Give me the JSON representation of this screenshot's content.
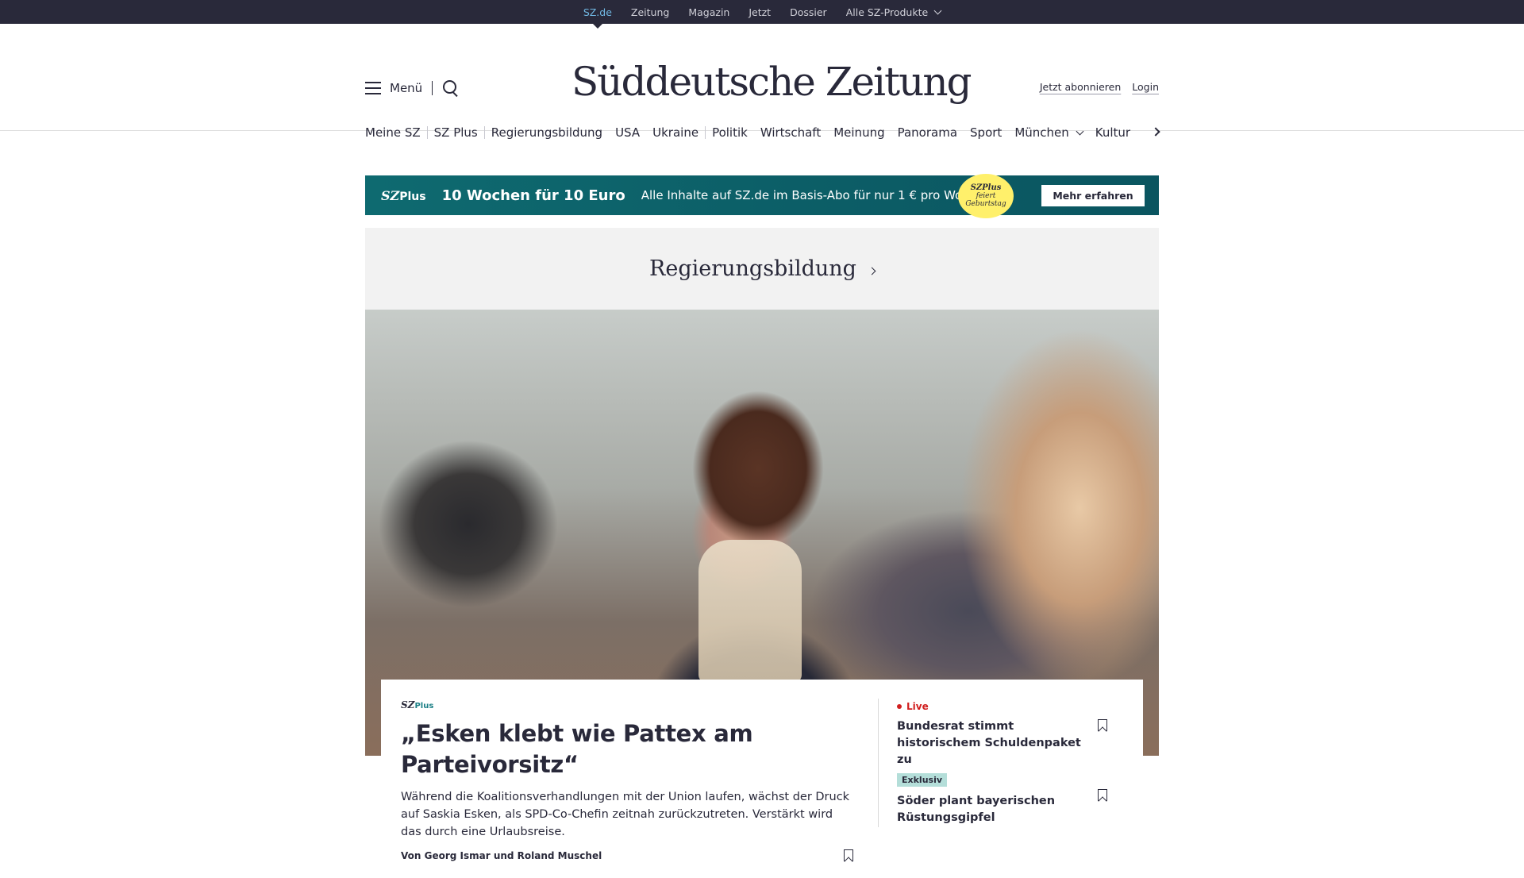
{
  "topbar": {
    "items": [
      "SZ.de",
      "Zeitung",
      "Magazin",
      "Jetzt",
      "Dossier",
      "Alle SZ-Produkte"
    ]
  },
  "header": {
    "menu_label": "Menü",
    "logo": "Süddeutsche Zeitung",
    "subscribe_label": "Jetzt abonnieren",
    "login_label": "Login"
  },
  "nav": {
    "items": [
      "Meine SZ",
      "SZ Plus",
      "Regierungsbildung",
      "USA",
      "Ukraine",
      "Politik",
      "Wirtschaft",
      "Meinung",
      "Panorama",
      "Sport",
      "München",
      "Kultur"
    ]
  },
  "banner": {
    "brand": "SZ",
    "brand_suffix": "Plus",
    "headline": "10 Wochen für 10 Euro",
    "subline": "Alle Inhalte auf SZ.de im Basis-Abo für nur 1 € pro Woche.",
    "badge_brand": "SZPlus",
    "badge_line1": "feiert",
    "badge_line2": "Geburtstag",
    "cta_label": "Mehr erfahren",
    "bg_color": "#0e6a70",
    "badge_color": "#fff06b"
  },
  "section": {
    "title": "Regierungsbildung"
  },
  "lead_article": {
    "brand": "SZ",
    "brand_suffix": "Plus",
    "headline": "„Esken klebt wie Pattex am Parteivorsitz“",
    "teaser": "Während die Koalitionsverhandlungen mit der Union laufen, wächst der Druck auf Saskia Esken, als SPD-Co-Chefin zeitnah zurückzutreten. Verstärkt wird das durch eine Urlaubsreise.",
    "byline": "Von Georg Ismar und Roland Muschel"
  },
  "side_articles": [
    {
      "tag": "Live",
      "title": "Bundesrat stimmt historischem Schuldenpaket zu",
      "tag_color": "#d11f1f"
    },
    {
      "tag": "Exklusiv",
      "title": "Söder plant bayerischen Rüstungsgipfel",
      "tag_color": "#b4ded9"
    }
  ]
}
